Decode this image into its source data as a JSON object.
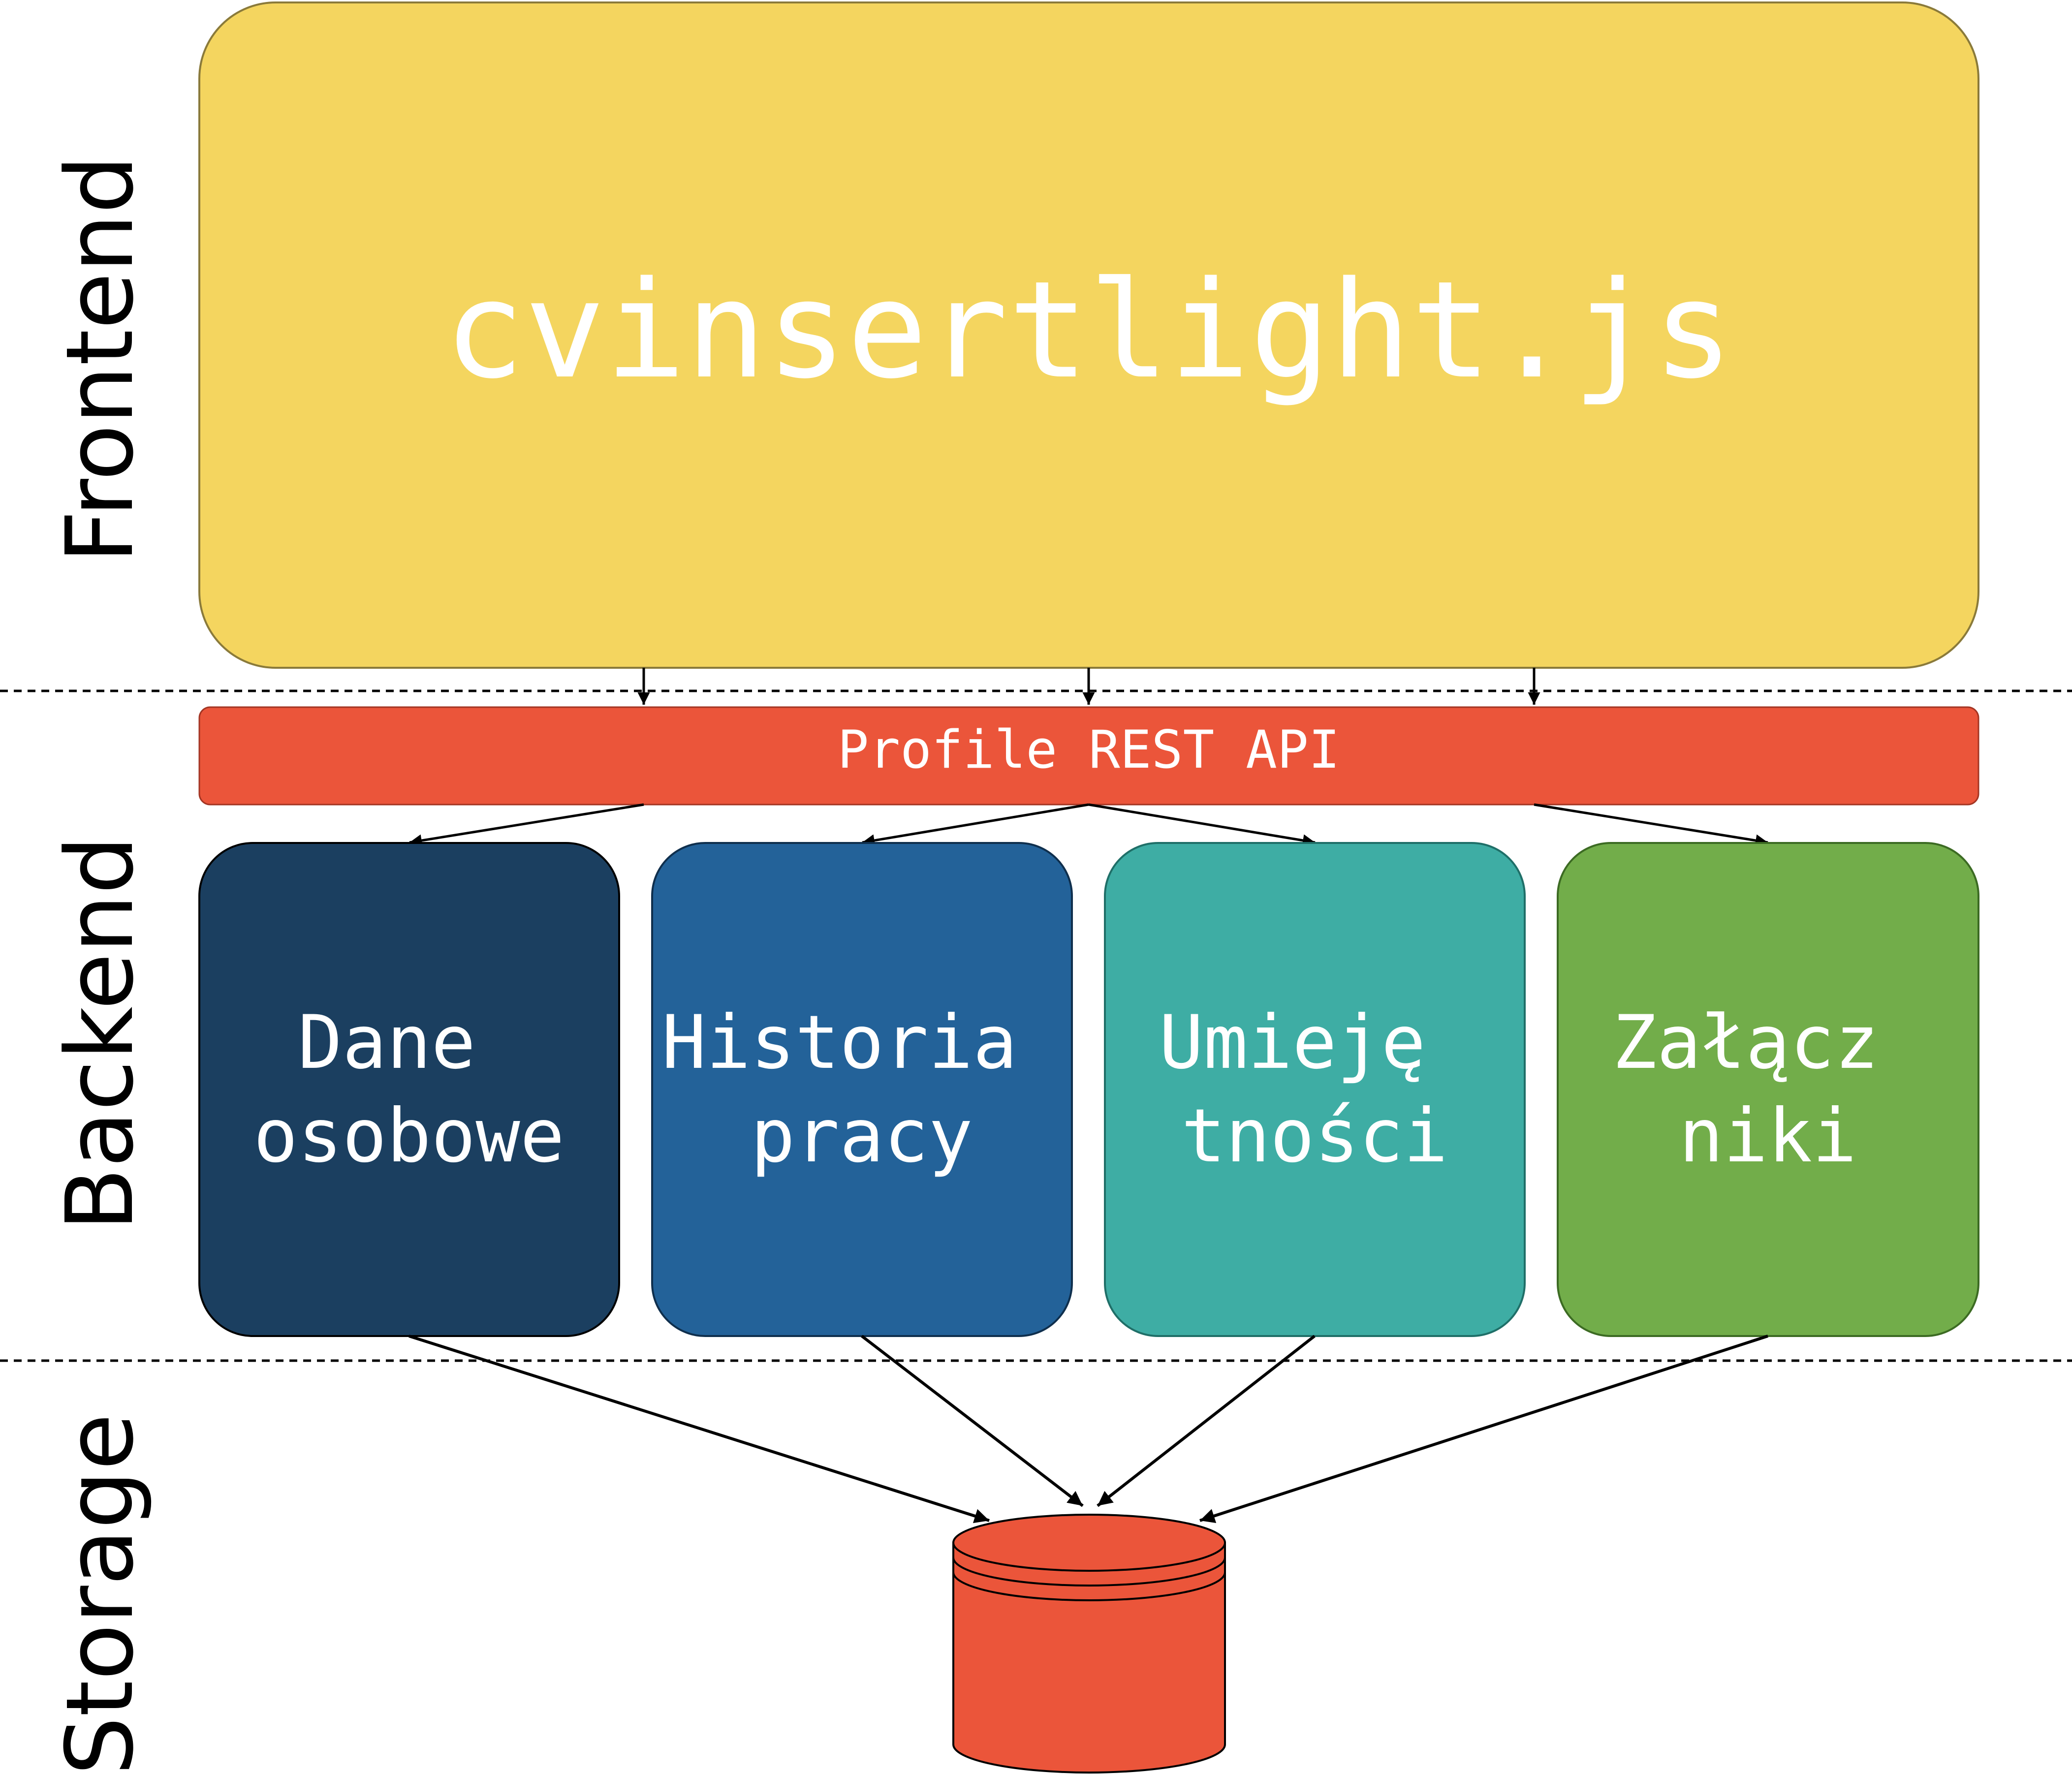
{
  "layers": {
    "frontend": "Frontend",
    "backend": "Backend",
    "storage": "Storage"
  },
  "frontend_box": {
    "label": "cvinsertlight.js",
    "color": "#F4D55F"
  },
  "api_bar": {
    "label": "Profile REST API",
    "color": "#EB553A"
  },
  "services": [
    {
      "line1": "Dane",
      "line2": "osobowe",
      "color": "#1B3F60"
    },
    {
      "line1": "Historia",
      "line2": "pracy",
      "color": "#236299"
    },
    {
      "line1": "Umieję",
      "line2": "tności",
      "color": "#3EADA4"
    },
    {
      "line1": "Załącz",
      "line2": "niki",
      "color": "#72AD4A"
    }
  ],
  "database": {
    "icon": "database-icon",
    "color": "#EB553A"
  }
}
